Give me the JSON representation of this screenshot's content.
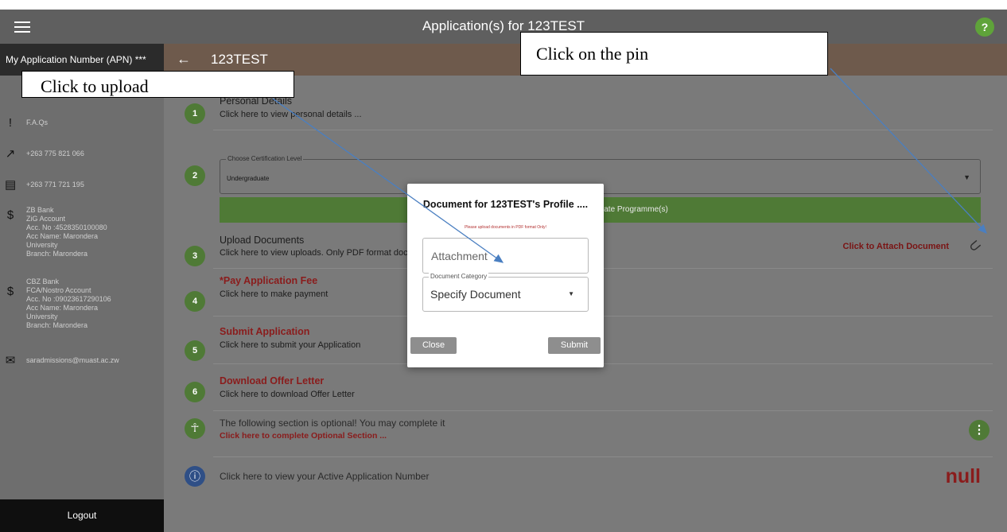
{
  "header": {
    "title": "Application(s) for 123TEST",
    "help_label": "?"
  },
  "sidebar": {
    "apn_label": "My Application Number (APN) ***",
    "items": [
      {
        "icon": "faq-icon",
        "glyph": "!",
        "text": "F.A.Qs"
      },
      {
        "icon": "call-made-icon",
        "glyph": "↗",
        "text": "+263 775 821 066"
      },
      {
        "icon": "message-icon",
        "glyph": "▤",
        "text": "+263 771 721 195"
      },
      {
        "icon": "currency-icon",
        "glyph": "$",
        "text": "ZB Bank\nZiG Account\nAcc. No :4528350100080\nAcc Name: Marondera\nUniversity\nBranch: Marondera"
      },
      {
        "icon": "currency-icon",
        "glyph": "$",
        "text": "CBZ Bank\nFCA/Nostro Account\nAcc. No :09023617290106\nAcc Name: Marondera\nUniversity\nBranch: Marondera"
      },
      {
        "icon": "mail-icon",
        "glyph": "✉",
        "text": "saradmissions@muast.ac.zw"
      }
    ],
    "logout": "Logout"
  },
  "subbar": {
    "back": "←",
    "app_name": "123TEST"
  },
  "steps": {
    "s1": {
      "num": "1",
      "title": "Personal Details",
      "sub": "Click here to view personal details ..."
    },
    "s2": {
      "num": "2",
      "legend": "Choose Certification Level",
      "value": "Undergraduate",
      "button": "Choose Undergraduate Programme(s)"
    },
    "s3": {
      "num": "3",
      "title": "Upload Documents",
      "sub": "Click here to view uploads. Only PDF format documents are accepted",
      "attach": "Click to Attach Document"
    },
    "s4": {
      "num": "4",
      "title": "*Pay  Application Fee",
      "sub": "Click here to make payment"
    },
    "s5": {
      "num": "5",
      "title": "Submit Application",
      "sub": "Click here to submit your Application"
    },
    "s6": {
      "num": "6",
      "title": "Download Offer Letter",
      "sub": "Click here to download Offer Letter"
    },
    "optional": {
      "title": "The following section is optional! You may complete it",
      "sub": "Click here to complete Optional Section ..."
    },
    "apn": {
      "text": "Click here to view your Active Application Number",
      "value": "null"
    }
  },
  "modal": {
    "title": "Document for 123TEST's  Profile ....",
    "note": "Please upload documents in PDF format Only!",
    "attachment_placeholder": "Attachment",
    "category_legend": "Document Category",
    "category_value": "Specify Document",
    "close": "Close",
    "submit": "Submit"
  },
  "callouts": {
    "upload": "Click to upload",
    "pin": "Click on the pin"
  },
  "colors": {
    "accent_green": "#4f7a36",
    "subbar_brown": "#6e5a4c",
    "danger_red": "#8a1c1c",
    "arrow_blue": "#4a7fc1"
  }
}
